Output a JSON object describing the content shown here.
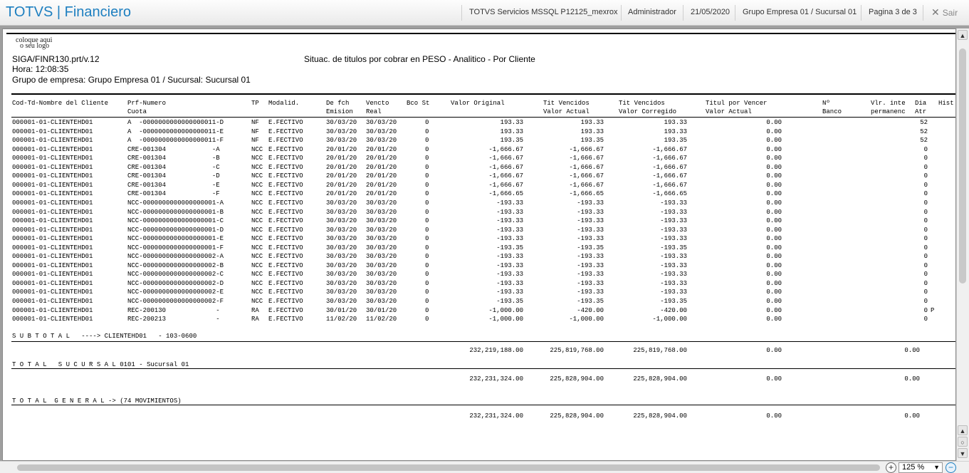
{
  "app": {
    "title_part1": "TOTVS",
    "separator": "|",
    "title_part2": "Financiero"
  },
  "toolbar": {
    "server": "TOTVS Servicios MSSQL P12125_mexrox",
    "user": "Administrador",
    "date": "21/05/2020",
    "company": "Grupo Empresa 01 / Sucursal 01",
    "page": "Pagina 3 de 3",
    "exit_label": "Sair"
  },
  "report": {
    "logo_line1": "coloque aqui",
    "logo_line2": "o seu logo",
    "program": "SIGA/FINR130.prt/v.12",
    "title": "Situac. de titulos por cobrar en PESO - Analitico - Por Cliente",
    "hora": "Hora: 12:08:35",
    "grupo": "Grupo de empresa: Grupo Empresa 01 / Sucursal: Sucursal 01",
    "columns": [
      {
        "l1": "Cod-Td-Nombre del Cliente",
        "l2": ""
      },
      {
        "l1": "Prf-Numero",
        "l2": "Cuota"
      },
      {
        "l1": "TP",
        "l2": ""
      },
      {
        "l1": "Modalid.",
        "l2": ""
      },
      {
        "l1": "De fch",
        "l2": "Emision"
      },
      {
        "l1": "Vencto",
        "l2": "Real"
      },
      {
        "l1": "Bco St",
        "l2": ""
      },
      {
        "l1": "Valor Original",
        "l2": ""
      },
      {
        "l1": "Tit Vencidos",
        "l2": "Valor Actual"
      },
      {
        "l1": "Tit Vencidos",
        "l2": "Valor Corregido"
      },
      {
        "l1": "Titul por Vencer",
        "l2": "Valor Actual"
      },
      {
        "l1": "Nº",
        "l2": "Banco"
      },
      {
        "l1": "Vlr. inte",
        "l2": "permanenc"
      },
      {
        "l1": "Dia",
        "l2": "Atr"
      },
      {
        "l1": "Hist",
        "l2": ""
      }
    ],
    "rows": [
      [
        "000001-01-CLIENTEHD01",
        "A  -0000000000000000011-D",
        "NF",
        "E.FECTIVO",
        "30/03/20",
        "30/03/20",
        "0",
        "193.33",
        "193.33",
        "193.33",
        "0.00",
        "52",
        ""
      ],
      [
        "000001-01-CLIENTEHD01",
        "A  -0000000000000000011-E",
        "NF",
        "E.FECTIVO",
        "30/03/20",
        "30/03/20",
        "0",
        "193.33",
        "193.33",
        "193.33",
        "0.00",
        "52",
        ""
      ],
      [
        "000001-01-CLIENTEHD01",
        "A  -0000000000000000011-F",
        "NF",
        "E.FECTIVO",
        "30/03/20",
        "30/03/20",
        "0",
        "193.35",
        "193.35",
        "193.35",
        "0.00",
        "52",
        ""
      ],
      [
        "000001-01-CLIENTEHD01",
        "CRE-001304            -A",
        "NCC",
        "E.FECTIVO",
        "20/01/20",
        "20/01/20",
        "0",
        "-1,666.67",
        "-1,666.67",
        "-1,666.67",
        "0.00",
        "0",
        ""
      ],
      [
        "000001-01-CLIENTEHD01",
        "CRE-001304            -B",
        "NCC",
        "E.FECTIVO",
        "20/01/20",
        "20/01/20",
        "0",
        "-1,666.67",
        "-1,666.67",
        "-1,666.67",
        "0.00",
        "0",
        ""
      ],
      [
        "000001-01-CLIENTEHD01",
        "CRE-001304            -C",
        "NCC",
        "E.FECTIVO",
        "20/01/20",
        "20/01/20",
        "0",
        "-1,666.67",
        "-1,666.67",
        "-1,666.67",
        "0.00",
        "0",
        ""
      ],
      [
        "000001-01-CLIENTEHD01",
        "CRE-001304            -D",
        "NCC",
        "E.FECTIVO",
        "20/01/20",
        "20/01/20",
        "0",
        "-1,666.67",
        "-1,666.67",
        "-1,666.67",
        "0.00",
        "0",
        ""
      ],
      [
        "000001-01-CLIENTEHD01",
        "CRE-001304            -E",
        "NCC",
        "E.FECTIVO",
        "20/01/20",
        "20/01/20",
        "0",
        "-1,666.67",
        "-1,666.67",
        "-1,666.67",
        "0.00",
        "0",
        ""
      ],
      [
        "000001-01-CLIENTEHD01",
        "CRE-001304            -F",
        "NCC",
        "E.FECTIVO",
        "20/01/20",
        "20/01/20",
        "0",
        "-1,666.65",
        "-1,666.65",
        "-1,666.65",
        "0.00",
        "0",
        ""
      ],
      [
        "000001-01-CLIENTEHD01",
        "NCC-0000000000000000001-A",
        "NCC",
        "E.FECTIVO",
        "30/03/20",
        "30/03/20",
        "0",
        "-193.33",
        "-193.33",
        "-193.33",
        "0.00",
        "0",
        ""
      ],
      [
        "000001-01-CLIENTEHD01",
        "NCC-0000000000000000001-B",
        "NCC",
        "E.FECTIVO",
        "30/03/20",
        "30/03/20",
        "0",
        "-193.33",
        "-193.33",
        "-193.33",
        "0.00",
        "0",
        ""
      ],
      [
        "000001-01-CLIENTEHD01",
        "NCC-0000000000000000001-C",
        "NCC",
        "E.FECTIVO",
        "30/03/20",
        "30/03/20",
        "0",
        "-193.33",
        "-193.33",
        "-193.33",
        "0.00",
        "0",
        ""
      ],
      [
        "000001-01-CLIENTEHD01",
        "NCC-0000000000000000001-D",
        "NCC",
        "E.FECTIVO",
        "30/03/20",
        "30/03/20",
        "0",
        "-193.33",
        "-193.33",
        "-193.33",
        "0.00",
        "0",
        ""
      ],
      [
        "000001-01-CLIENTEHD01",
        "NCC-0000000000000000001-E",
        "NCC",
        "E.FECTIVO",
        "30/03/20",
        "30/03/20",
        "0",
        "-193.33",
        "-193.33",
        "-193.33",
        "0.00",
        "0",
        ""
      ],
      [
        "000001-01-CLIENTEHD01",
        "NCC-0000000000000000001-F",
        "NCC",
        "E.FECTIVO",
        "30/03/20",
        "30/03/20",
        "0",
        "-193.35",
        "-193.35",
        "-193.35",
        "0.00",
        "0",
        ""
      ],
      [
        "000001-01-CLIENTEHD01",
        "NCC-0000000000000000002-A",
        "NCC",
        "E.FECTIVO",
        "30/03/20",
        "30/03/20",
        "0",
        "-193.33",
        "-193.33",
        "-193.33",
        "0.00",
        "0",
        ""
      ],
      [
        "000001-01-CLIENTEHD01",
        "NCC-0000000000000000002-B",
        "NCC",
        "E.FECTIVO",
        "30/03/20",
        "30/03/20",
        "0",
        "-193.33",
        "-193.33",
        "-193.33",
        "0.00",
        "0",
        ""
      ],
      [
        "000001-01-CLIENTEHD01",
        "NCC-0000000000000000002-C",
        "NCC",
        "E.FECTIVO",
        "30/03/20",
        "30/03/20",
        "0",
        "-193.33",
        "-193.33",
        "-193.33",
        "0.00",
        "0",
        ""
      ],
      [
        "000001-01-CLIENTEHD01",
        "NCC-0000000000000000002-D",
        "NCC",
        "E.FECTIVO",
        "30/03/20",
        "30/03/20",
        "0",
        "-193.33",
        "-193.33",
        "-193.33",
        "0.00",
        "0",
        ""
      ],
      [
        "000001-01-CLIENTEHD01",
        "NCC-0000000000000000002-E",
        "NCC",
        "E.FECTIVO",
        "30/03/20",
        "30/03/20",
        "0",
        "-193.33",
        "-193.33",
        "-193.33",
        "0.00",
        "0",
        ""
      ],
      [
        "000001-01-CLIENTEHD01",
        "NCC-0000000000000000002-F",
        "NCC",
        "E.FECTIVO",
        "30/03/20",
        "30/03/20",
        "0",
        "-193.35",
        "-193.35",
        "-193.35",
        "0.00",
        "0",
        ""
      ],
      [
        "000001-01-CLIENTEHD01",
        "REC-200130             -",
        "RA",
        "E.FECTIVO",
        "30/01/20",
        "30/01/20",
        "0",
        "-1,000.00",
        "-420.00",
        "-420.00",
        "0.00",
        "0",
        "P"
      ],
      [
        "000001-01-CLIENTEHD01",
        "REC-200213             -",
        "RA",
        "E.FECTIVO",
        "11/02/20",
        "11/02/20",
        "0",
        "-1,000.00",
        "-1,000.00",
        "-1,000.00",
        "0.00",
        "0",
        ""
      ]
    ],
    "subtotal": {
      "label": "S U B T O T A L   ----> CLIENTEHD01   - 103-0600",
      "original": "232,219,188.00",
      "actual": "225,819,768.00",
      "corregido": "225,819,768.00",
      "vencer": "0.00",
      "inte": "0.00"
    },
    "total_sucursal": {
      "label": "T O T A L   S U C U R S A L 0101 - Sucursal 01",
      "original": "232,231,324.00",
      "actual": "225,828,904.00",
      "corregido": "225,828,904.00",
      "vencer": "0.00",
      "inte": "0.00"
    },
    "total_general": {
      "label": "T O T A L  G E N E R A L -> (74 MOVIMIENTOS)",
      "original": "232,231,324.00",
      "actual": "225,828,904.00",
      "corregido": "225,828,904.00",
      "vencer": "0.00",
      "inte": "0.00"
    }
  },
  "viewer": {
    "zoom": "125 %",
    "zoom_in": "+",
    "zoom_out": "−",
    "scroll_up": "▲",
    "scroll_down": "▼",
    "scroll_mid": "○"
  }
}
